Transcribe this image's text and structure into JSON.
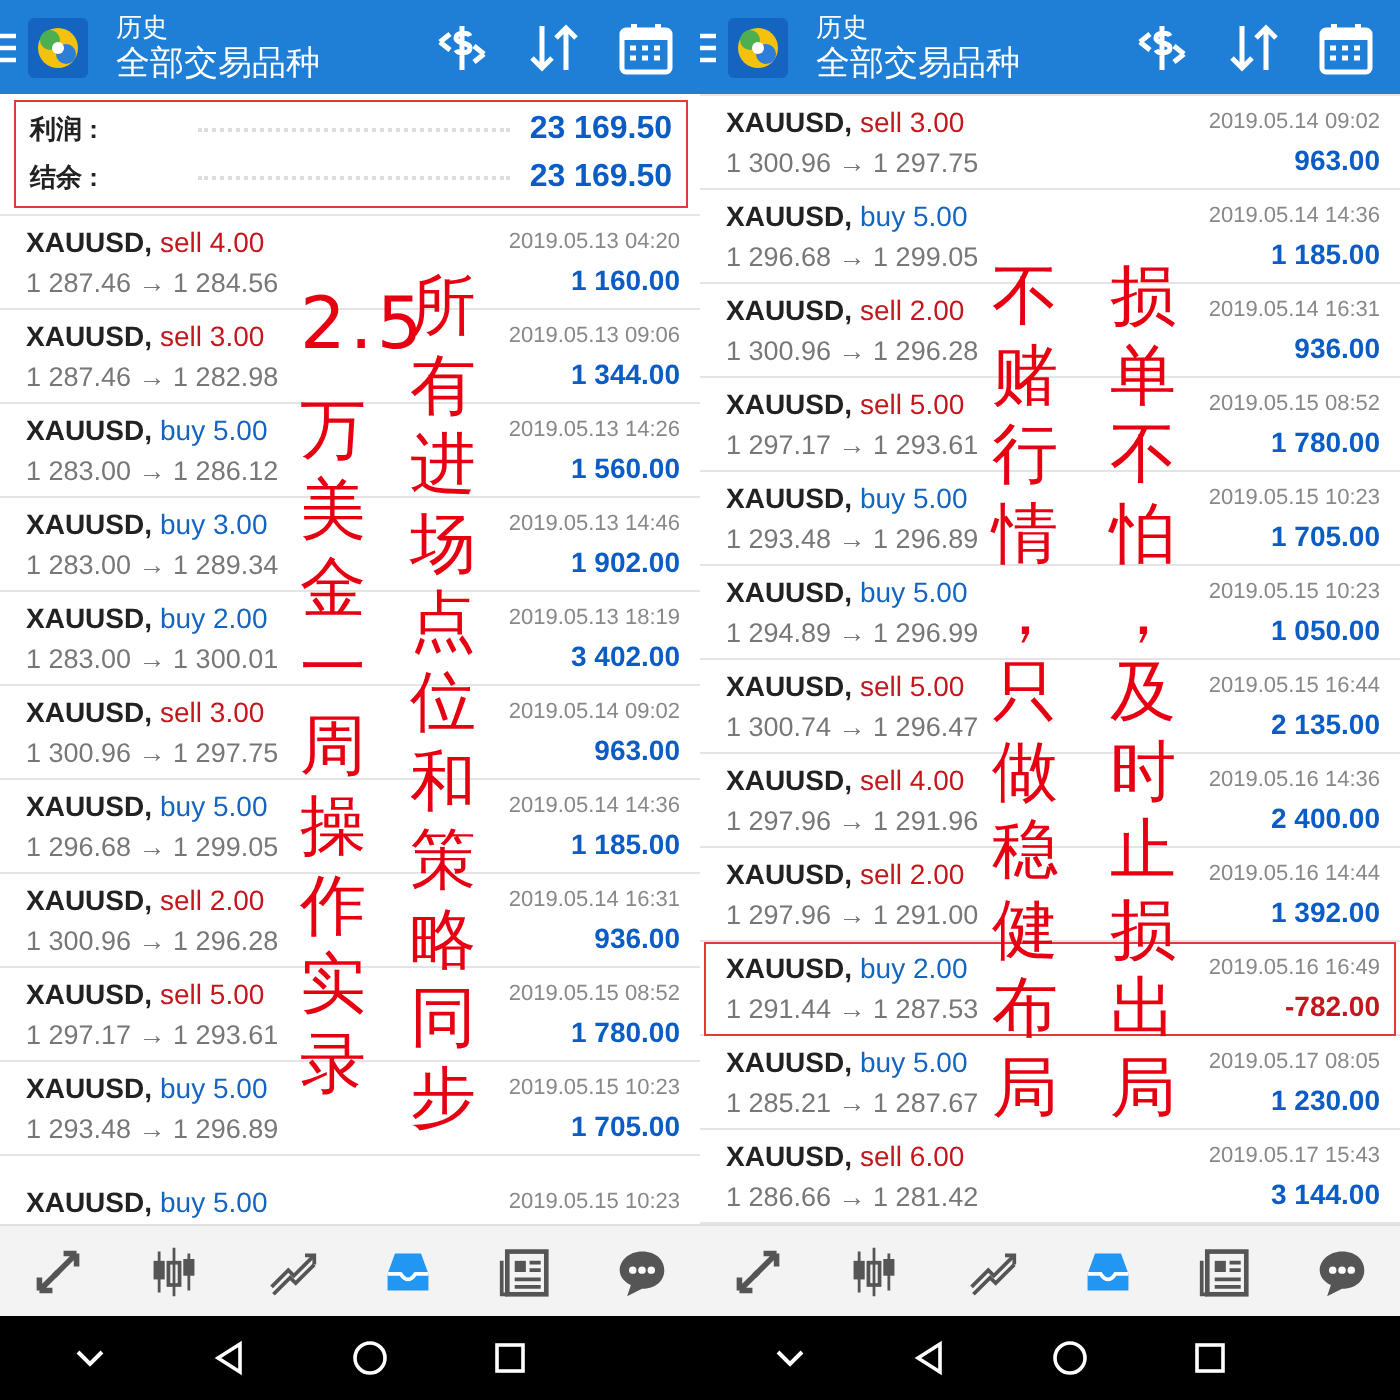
{
  "phones": [
    {
      "header": {
        "title": "历史",
        "subtitle": "全部交易品种"
      },
      "summary": {
        "highlighted": true,
        "items": [
          {
            "label": "利润 :",
            "value": "23 169.50"
          },
          {
            "label": "结余 :",
            "value": "23 169.50"
          }
        ]
      },
      "trades": [
        {
          "symbol": "XAUUSD,",
          "kind": "sell",
          "order": "sell 4.00",
          "prices": "1 287.46 → 1 284.56",
          "time": "2019.05.13 04:20",
          "profit": "1 160.00",
          "loss": false,
          "highlighted": false
        },
        {
          "symbol": "XAUUSD,",
          "kind": "sell",
          "order": "sell 3.00",
          "prices": "1 287.46 → 1 282.98",
          "time": "2019.05.13 09:06",
          "profit": "1 344.00",
          "loss": false,
          "highlighted": false
        },
        {
          "symbol": "XAUUSD,",
          "kind": "buy",
          "order": "buy 5.00",
          "prices": "1 283.00 → 1 286.12",
          "time": "2019.05.13 14:26",
          "profit": "1 560.00",
          "loss": false,
          "highlighted": false
        },
        {
          "symbol": "XAUUSD,",
          "kind": "buy",
          "order": "buy 3.00",
          "prices": "1 283.00 → 1 289.34",
          "time": "2019.05.13 14:46",
          "profit": "1 902.00",
          "loss": false,
          "highlighted": false
        },
        {
          "symbol": "XAUUSD,",
          "kind": "buy",
          "order": "buy 2.00",
          "prices": "1 283.00 → 1 300.01",
          "time": "2019.05.13 18:19",
          "profit": "3 402.00",
          "loss": false,
          "highlighted": false
        },
        {
          "symbol": "XAUUSD,",
          "kind": "sell",
          "order": "sell 3.00",
          "prices": "1 300.96 → 1 297.75",
          "time": "2019.05.14 09:02",
          "profit": "963.00",
          "loss": false,
          "highlighted": false
        },
        {
          "symbol": "XAUUSD,",
          "kind": "buy",
          "order": "buy 5.00",
          "prices": "1 296.68 → 1 299.05",
          "time": "2019.05.14 14:36",
          "profit": "1 185.00",
          "loss": false,
          "highlighted": false
        },
        {
          "symbol": "XAUUSD,",
          "kind": "sell",
          "order": "sell 2.00",
          "prices": "1 300.96 → 1 296.28",
          "time": "2019.05.14 16:31",
          "profit": "936.00",
          "loss": false,
          "highlighted": false
        },
        {
          "symbol": "XAUUSD,",
          "kind": "sell",
          "order": "sell 5.00",
          "prices": "1 297.17 → 1 293.61",
          "time": "2019.05.15 08:52",
          "profit": "1 780.00",
          "loss": false,
          "highlighted": false
        },
        {
          "symbol": "XAUUSD,",
          "kind": "buy",
          "order": "buy 5.00",
          "prices": "1 293.48 → 1 296.89",
          "time": "2019.05.15 10:23",
          "profit": "1 705.00",
          "loss": false,
          "highlighted": false
        },
        {
          "symbol": "XAUUSD,",
          "kind": "buy",
          "order": "buy 5.00",
          "time": "2019.05.15 10:23",
          "highlighted": false
        }
      ],
      "captions": [
        {
          "text": "2.5"
        },
        {
          "text": "万美金一周操作实录"
        },
        {
          "text": "所有进场点位和策略同步"
        }
      ],
      "nav": [
        {
          "selected": false
        },
        {
          "selected": false
        },
        {
          "selected": false
        },
        {
          "selected": true
        },
        {
          "selected": false
        },
        {
          "selected": false
        }
      ]
    },
    {
      "header": {
        "title": "历史",
        "subtitle": "全部交易品种"
      },
      "trades": [
        {
          "symbol": "XAUUSD,",
          "kind": "sell",
          "order": "sell 3.00",
          "prices": "1 300.96 → 1 297.75",
          "time": "2019.05.14 09:02",
          "profit": "963.00",
          "loss": false,
          "highlighted": false
        },
        {
          "symbol": "XAUUSD,",
          "kind": "buy",
          "order": "buy 5.00",
          "prices": "1 296.68 → 1 299.05",
          "time": "2019.05.14 14:36",
          "profit": "1 185.00",
          "loss": false,
          "highlighted": false
        },
        {
          "symbol": "XAUUSD,",
          "kind": "sell",
          "order": "sell 2.00",
          "prices": "1 300.96 → 1 296.28",
          "time": "2019.05.14 16:31",
          "profit": "936.00",
          "loss": false,
          "highlighted": false
        },
        {
          "symbol": "XAUUSD,",
          "kind": "sell",
          "order": "sell 5.00",
          "prices": "1 297.17 → 1 293.61",
          "time": "2019.05.15 08:52",
          "profit": "1 780.00",
          "loss": false,
          "highlighted": false
        },
        {
          "symbol": "XAUUSD,",
          "kind": "buy",
          "order": "buy 5.00",
          "prices": "1 293.48 → 1 296.89",
          "time": "2019.05.15 10:23",
          "profit": "1 705.00",
          "loss": false,
          "highlighted": false
        },
        {
          "symbol": "XAUUSD,",
          "kind": "buy",
          "order": "buy 5.00",
          "prices": "1 294.89 → 1 296.99",
          "time": "2019.05.15 10:23",
          "profit": "1 050.00",
          "loss": false,
          "highlighted": false
        },
        {
          "symbol": "XAUUSD,",
          "kind": "sell",
          "order": "sell 5.00",
          "prices": "1 300.74 → 1 296.47",
          "time": "2019.05.15 16:44",
          "profit": "2 135.00",
          "loss": false,
          "highlighted": false
        },
        {
          "symbol": "XAUUSD,",
          "kind": "sell",
          "order": "sell 4.00",
          "prices": "1 297.96 → 1 291.96",
          "time": "2019.05.16 14:36",
          "profit": "2 400.00",
          "loss": false,
          "highlighted": false
        },
        {
          "symbol": "XAUUSD,",
          "kind": "sell",
          "order": "sell 2.00",
          "prices": "1 297.96 → 1 291.00",
          "time": "2019.05.16 14:44",
          "profit": "1 392.00",
          "loss": false,
          "highlighted": false
        },
        {
          "symbol": "XAUUSD,",
          "kind": "buy",
          "order": "buy 2.00",
          "prices": "1 291.44 → 1 287.53",
          "time": "2019.05.16 16:49",
          "profit": "-782.00",
          "loss": true,
          "highlighted": true
        },
        {
          "symbol": "XAUUSD,",
          "kind": "buy",
          "order": "buy 5.00",
          "prices": "1 285.21 → 1 287.67",
          "time": "2019.05.17 08:05",
          "profit": "1 230.00",
          "loss": false,
          "highlighted": false
        },
        {
          "symbol": "XAUUSD,",
          "kind": "sell",
          "order": "sell 6.00",
          "prices": "1 286.66 → 1 281.42",
          "time": "2019.05.17 15:43",
          "profit": "3 144.00",
          "loss": false,
          "highlighted": false
        }
      ],
      "captions": [
        {
          "text": "不赌行情，只做稳健布局"
        },
        {
          "text": "损单不怕，及时止损出局"
        }
      ],
      "nav": [
        {
          "selected": false
        },
        {
          "selected": false
        },
        {
          "selected": false
        },
        {
          "selected": true
        },
        {
          "selected": false
        },
        {
          "selected": false
        }
      ]
    }
  ]
}
